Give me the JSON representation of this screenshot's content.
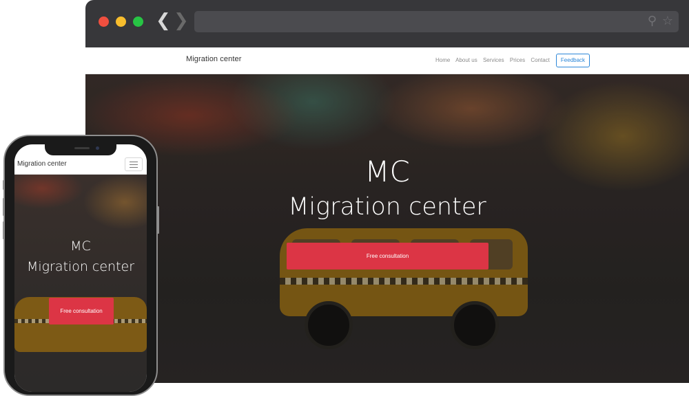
{
  "browser": {
    "window_controls": [
      "close",
      "minimize",
      "maximize"
    ],
    "nav": {
      "back_icon": "chevron-left-icon",
      "forward_icon": "chevron-right-icon"
    },
    "address_bar": {
      "value": "",
      "icons": [
        "search-icon",
        "star-icon"
      ]
    }
  },
  "site": {
    "brand": "Migration center",
    "menu": [
      "Home",
      "About us",
      "Services",
      "Prices",
      "Contact"
    ],
    "feedback_label": "Feedback",
    "hero": {
      "title": "MC",
      "subtitle": "Migration center",
      "cta_label": "Free consultation"
    }
  },
  "mobile": {
    "brand": "Migration center",
    "menu_icon": "hamburger-icon",
    "hero": {
      "title": "MC",
      "subtitle": "Migration center",
      "cta_label": "Free consultation"
    }
  },
  "colors": {
    "accent_red": "#dc3545",
    "feedback_blue": "#2a86d8",
    "chrome_dark": "#37373a",
    "close_red": "#ef4f3f",
    "minimize_yellow": "#f7bd2d",
    "maximize_green": "#27c444"
  }
}
